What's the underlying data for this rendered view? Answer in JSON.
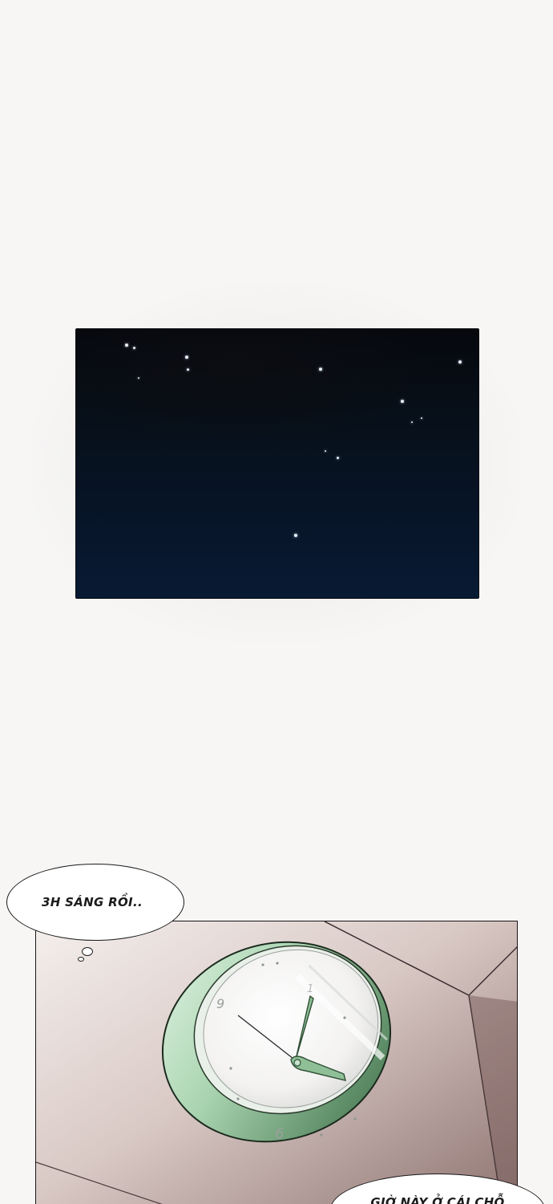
{
  "bubbles": {
    "first": "3H SÁNG RỒI..",
    "second": "GIỜ NÀY Ở CÁI CHỖ"
  },
  "clock": {
    "numerals": {
      "twelve_partial": "1",
      "nine": "9",
      "six": "6"
    }
  },
  "colors": {
    "page_background": "#f7f6f5",
    "sky_top": "#06080d",
    "sky_bottom": "#081a33",
    "clock_rim": "#9cc9a4",
    "clock_hand": "#8fbf96"
  }
}
